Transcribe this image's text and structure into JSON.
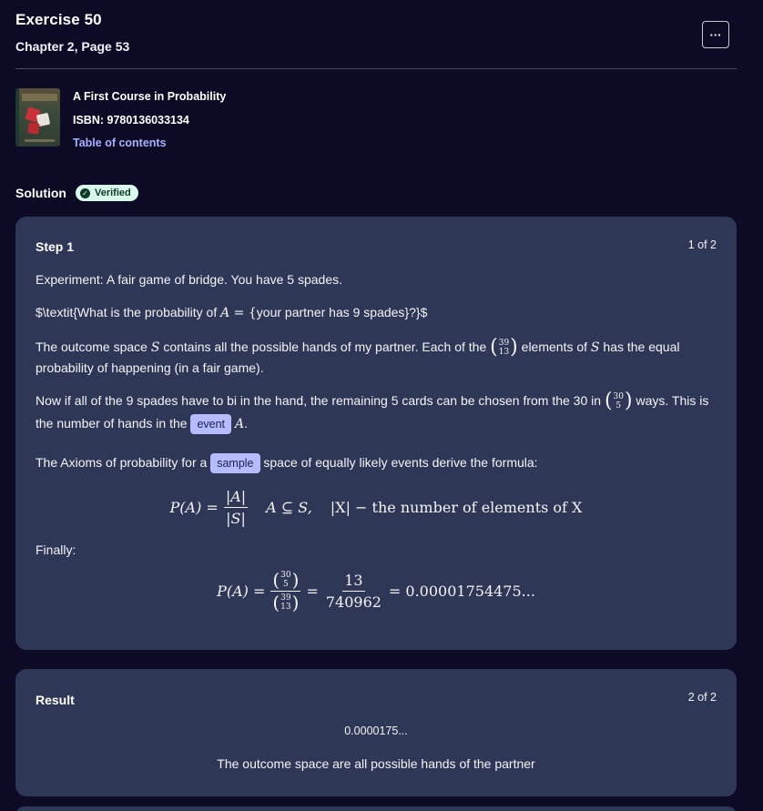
{
  "header": {
    "title": "Exercise 50",
    "subtitle": "Chapter 2, Page 53",
    "more_icon": "···"
  },
  "book": {
    "cover_icon": "book-cover",
    "title": "A First Course in Probability",
    "isbn": "ISBN: 9780136033134",
    "toc_link": "Table of contents"
  },
  "solution": {
    "label": "Solution",
    "badge": "Verified",
    "badge_icon": "✓"
  },
  "step1": {
    "title": "Step 1",
    "count": "1 of 2",
    "line1": "Experiment: A fair game of bridge. You have 5 spades.",
    "line2_pre": "$\\textit{What is the probability of ",
    "line2_math": "A",
    "line2_eq": " = {",
    "line2_text": "your partner has 9 spades",
    "line2_post": "}?}$",
    "line3_a": "The outcome space ",
    "line3_S": "S",
    "line3_b": " contains all the possible hands of my partner. Each of the ",
    "line3_binom_top": "39",
    "line3_binom_bot": "13",
    "line3_c": " elements of ",
    "line3_S2": "S",
    "line3_d": " has the equal probability of happening (in a fair game).",
    "line4_a": "Now if all of the 9 spades have to bi in the hand, the remaining 5 cards can be chosen from the 30 in ",
    "line4_binom_top": "30",
    "line4_binom_bot": "5",
    "line4_b": " ways. This is the number of hands in the ",
    "chip_event": "event",
    "line4_A": "A",
    "line4_c": ".",
    "line5_a": "The Axioms of probability for a ",
    "chip_sample": "sample",
    "line5_b": " space of equally likely events derive the formula:",
    "formula1_lhs": "P(A) =",
    "formula1_num": "|A|",
    "formula1_den": "|S|",
    "formula1_cond": "A ⊆ S,",
    "formula1_rest": "|X| − the number of elements of X",
    "finally": "Finally:",
    "formula2_lhs": "P(A) =",
    "formula2_eq": "=",
    "formula2_num": "13",
    "formula2_den": "740962",
    "formula2_rhs": "= 0.00001754475..."
  },
  "result": {
    "title": "Result",
    "count": "2 of 2",
    "value": "0.0000175...",
    "text": "The outcome space are all possible hands of the partner"
  }
}
